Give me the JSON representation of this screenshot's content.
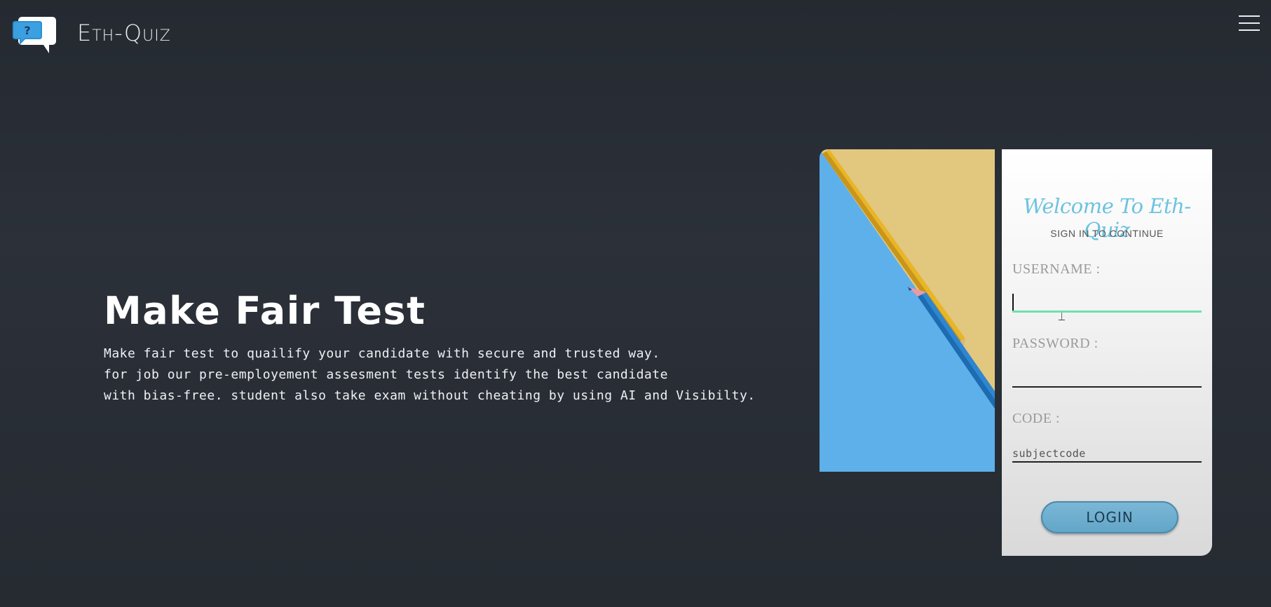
{
  "header": {
    "brand": "Eth-Quiz",
    "logo_icon": "chat-question-icon",
    "menu_icon": "hamburger-icon"
  },
  "hero": {
    "title": "Make Fair Test",
    "lines": [
      "Make fair test to quailify your candidate with secure and trusted way.",
      "for job our pre-employement assesment tests identify the best candidate",
      "with bias-free. student also take exam without cheating by using AI and Visibilty."
    ]
  },
  "login": {
    "welcome": "Welcome To Eth-Quiz",
    "subtitle": "SIGN IN TO CONTINUE",
    "username_label": "USERNAME :",
    "username_value": "",
    "password_label": "PASSWORD :",
    "password_value": "",
    "code_label": "CODE :",
    "code_placeholder": "subjectcode",
    "login_button": "LOGIN"
  },
  "colors": {
    "background": "#272c33",
    "accent": "#6cc3df",
    "active_field": "#6fe0b1",
    "button": "#6aaccd"
  }
}
